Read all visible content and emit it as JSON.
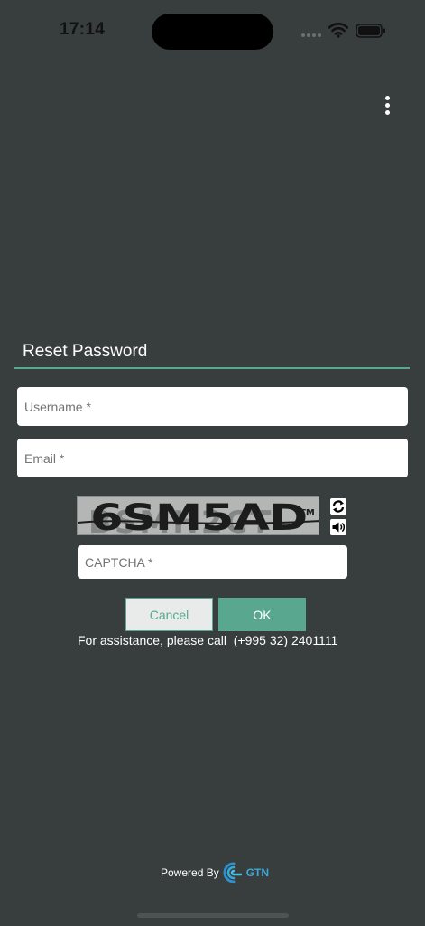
{
  "status_bar": {
    "time": "17:14"
  },
  "header": {
    "menu_icon": "kebab-menu-icon"
  },
  "form": {
    "title": "Reset Password",
    "username_placeholder": "Username *",
    "email_placeholder": "Email *",
    "captcha_placeholder": "CAPTCHA *",
    "captcha_code": "6SM5AD",
    "refresh_icon": "refresh-icon",
    "audio_icon": "speaker-icon",
    "cancel_label": "Cancel",
    "ok_label": "OK",
    "assistance_text": "For assistance, please call  (+995 32) 2401111"
  },
  "footer": {
    "powered_by": "Powered By",
    "brand": "GTN"
  },
  "colors": {
    "background": "#383e3e",
    "accent": "#5aa78f",
    "brand": "#3aa7d6"
  }
}
